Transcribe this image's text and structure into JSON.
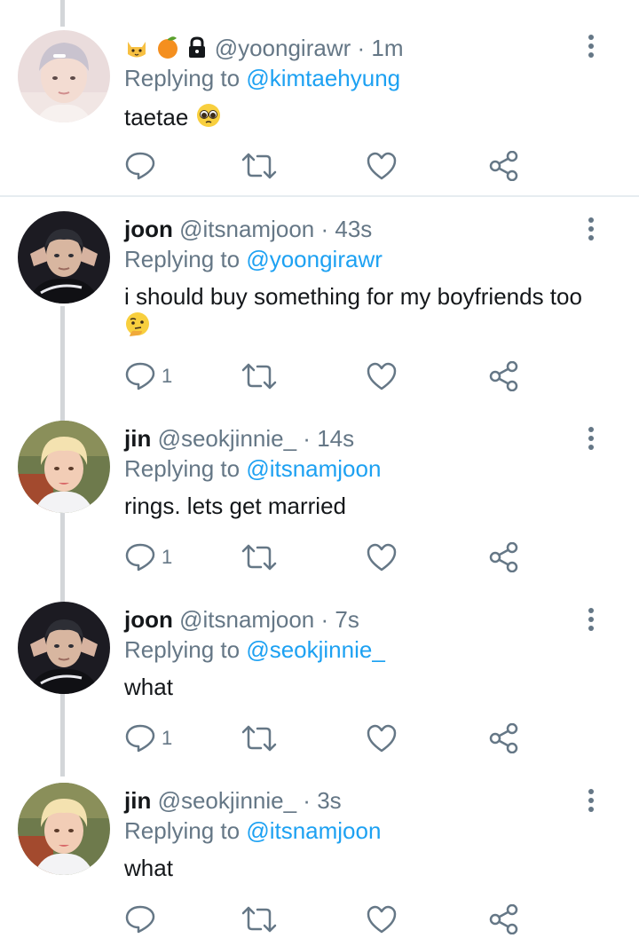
{
  "tweets": [
    {
      "name": "",
      "name_emojis": [
        "cat-emoji",
        "tangerine-emoji",
        "lock-icon"
      ],
      "handle": "@yoongirawr",
      "time": "1m",
      "replying_prefix": "Replying to",
      "replying_to": "@kimtaehyung",
      "text": "taetae",
      "text_emoji": "pleading-face-emoji",
      "reply_count": "",
      "avatar": "avatar-yoongirawr"
    },
    {
      "name": "joon",
      "handle": "@itsnamjoon",
      "time": "43s",
      "replying_prefix": "Replying to",
      "replying_to": "@yoongirawr",
      "text": "i should buy something for my boyfriends too",
      "text_emoji": "thinking-face-emoji",
      "reply_count": "1",
      "avatar": "avatar-itsnamjoon"
    },
    {
      "name": "jin",
      "handle": "@seokjinnie_",
      "time": "14s",
      "replying_prefix": "Replying to",
      "replying_to": "@itsnamjoon",
      "text": "rings. lets get married",
      "reply_count": "1",
      "avatar": "avatar-seokjinnie"
    },
    {
      "name": "joon",
      "handle": "@itsnamjoon",
      "time": "7s",
      "replying_prefix": "Replying to",
      "replying_to": "@seokjinnie_",
      "text": "what",
      "reply_count": "1",
      "avatar": "avatar-itsnamjoon"
    },
    {
      "name": "jin",
      "handle": "@seokjinnie_",
      "time": "3s",
      "replying_prefix": "Replying to",
      "replying_to": "@itsnamjoon",
      "text": "what",
      "reply_count": "",
      "avatar": "avatar-seokjinnie"
    }
  ],
  "separator": "·",
  "icons": {
    "reply": "reply-icon",
    "retweet": "retweet-icon",
    "like": "heart-icon",
    "share": "share-icon",
    "more": "more-vertical-icon"
  },
  "colors": {
    "link": "#1da1f2",
    "secondary_text": "#657786",
    "primary_text": "#14171a",
    "thread_line": "#d3d6d9"
  }
}
